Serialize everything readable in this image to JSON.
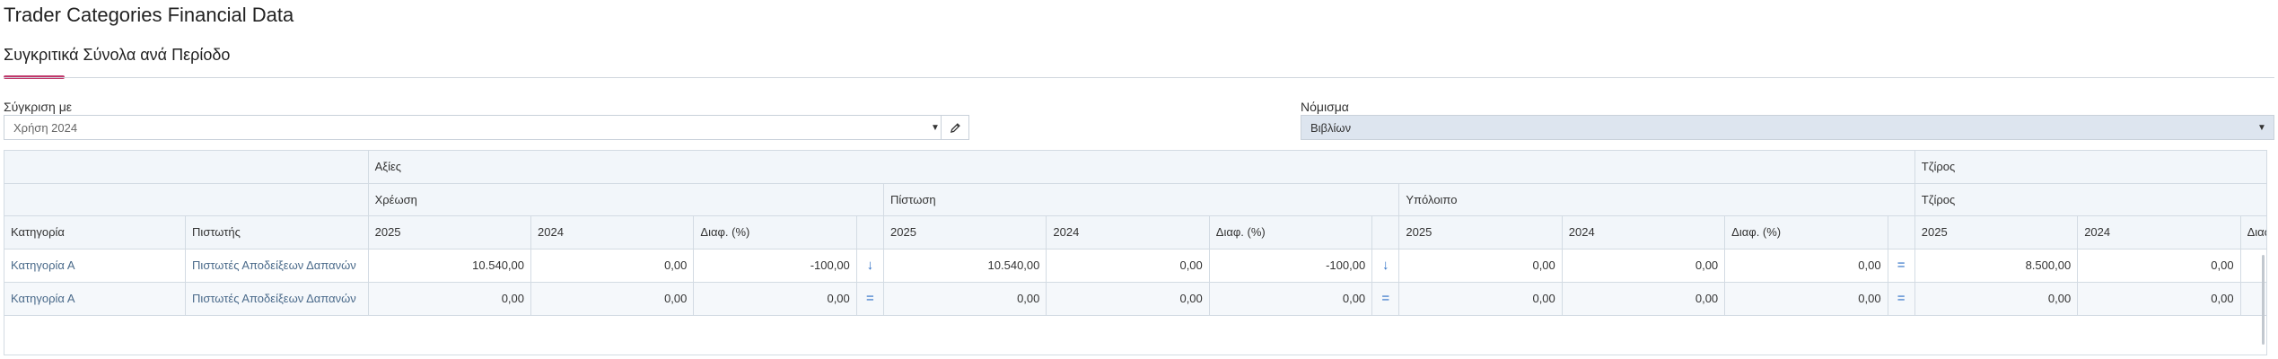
{
  "page": {
    "title": "Trader Categories Financial Data"
  },
  "tabs": [
    {
      "label": "Συγκριτικά Σύνολα ανά Περίοδο"
    }
  ],
  "filters": {
    "compare": {
      "label": "Σύγκριση με",
      "value": "Χρήση 2024"
    },
    "currency": {
      "label": "Νόμισμα",
      "value": "Βιβλίων"
    }
  },
  "grid": {
    "group1": {
      "values": "Αξίες",
      "turnover": "Τζίρος"
    },
    "group2": {
      "debit": "Χρέωση",
      "credit": "Πίστωση",
      "balance": "Υπόλοιπο",
      "turnover": "Τζίρος"
    },
    "cols": {
      "category": "Κατηγορία",
      "creditor": "Πιστωτής",
      "y2025": "2025",
      "y2024": "2024",
      "diff": "Διαφ. (%)"
    },
    "rows": [
      {
        "category": "Κατηγορία Α",
        "creditor": "Πιστωτές Αποδείξεων Δαπανών",
        "debit_2025": "10.540,00",
        "debit_2024": "0,00",
        "debit_diff": "-100,00",
        "debit_ind": "↓",
        "credit_2025": "10.540,00",
        "credit_2024": "0,00",
        "credit_diff": "-100,00",
        "credit_ind": "↓",
        "balance_2025": "0,00",
        "balance_2024": "0,00",
        "balance_diff": "0,00",
        "balance_ind": "=",
        "turnover_2025": "8.500,00",
        "turnover_2024": "0,00"
      },
      {
        "category": "Κατηγορία Α",
        "creditor": "Πιστωτές Αποδείξεων Δαπανών",
        "debit_2025": "0,00",
        "debit_2024": "0,00",
        "debit_diff": "0,00",
        "debit_ind": "=",
        "credit_2025": "0,00",
        "credit_2024": "0,00",
        "credit_diff": "0,00",
        "credit_ind": "=",
        "balance_2025": "0,00",
        "balance_2024": "0,00",
        "balance_diff": "0,00",
        "balance_ind": "=",
        "turnover_2025": "0,00",
        "turnover_2024": "0,00"
      }
    ]
  },
  "colors": {
    "accent": "#c0396b",
    "header_bg": "#f2f6fa",
    "indicator": "#2e6fc6"
  },
  "icons": {
    "edit": "pencil-icon",
    "dropdown": "caret-down-icon",
    "down": "arrow-down-icon",
    "equal": "equals-icon"
  }
}
